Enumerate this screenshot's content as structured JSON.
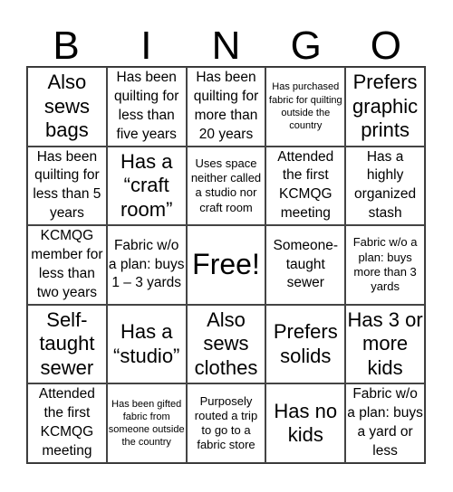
{
  "title": [
    "B",
    "I",
    "N",
    "G",
    "O"
  ],
  "cells": [
    {
      "text": "Also sews bags",
      "size": "s-l"
    },
    {
      "text": "Has been quilting for less than five years",
      "size": "s-m"
    },
    {
      "text": "Has been quilting for more than 20 years",
      "size": "s-m"
    },
    {
      "text": "Has purchased fabric for quilting outside the country",
      "size": "s-xs"
    },
    {
      "text": "Prefers graphic prints",
      "size": "s-l"
    },
    {
      "text": "Has been quilting for less than 5 years",
      "size": "s-m"
    },
    {
      "text": "Has a “craft room”",
      "size": "s-l"
    },
    {
      "text": "Uses space neither called a studio nor craft room",
      "size": "s-s"
    },
    {
      "text": "Attended the first KCMQG meeting",
      "size": "s-m"
    },
    {
      "text": "Has a highly organized stash",
      "size": "s-m"
    },
    {
      "text": "KCMQG member for less than two years",
      "size": "s-m"
    },
    {
      "text": "Fabric w/o a plan: buys 1 – 3 yards",
      "size": "s-m"
    },
    {
      "text": "Free!",
      "size": "s-xl"
    },
    {
      "text": "Someone-taught sewer",
      "size": "s-m"
    },
    {
      "text": "Fabric w/o a plan: buys more than 3 yards",
      "size": "s-s"
    },
    {
      "text": "Self-taught sewer",
      "size": "s-l"
    },
    {
      "text": "Has a “studio”",
      "size": "s-l"
    },
    {
      "text": "Also sews clothes",
      "size": "s-l"
    },
    {
      "text": "Prefers solids",
      "size": "s-l"
    },
    {
      "text": "Has 3 or more kids",
      "size": "s-l"
    },
    {
      "text": "Attended the first KCMQG meeting",
      "size": "s-m"
    },
    {
      "text": "Has been gifted fabric from someone outside the country",
      "size": "s-xs"
    },
    {
      "text": "Purposely routed a trip to go to a fabric store",
      "size": "s-s"
    },
    {
      "text": "Has no kids",
      "size": "s-l"
    },
    {
      "text": "Fabric w/o a plan: buys a yard or less",
      "size": "s-m"
    }
  ]
}
